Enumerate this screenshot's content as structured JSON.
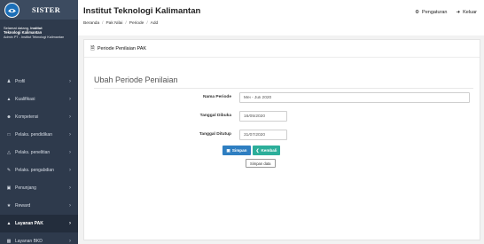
{
  "sidebar": {
    "brand": "SISTER",
    "welcome_prefix": "Selamat datang,",
    "username": "Institut",
    "institution": "Teknologi Kalimantan",
    "role": "Admin PT - Institut Teknologi Kalimantan",
    "items": [
      {
        "label": "Profil",
        "icon": "user-icon"
      },
      {
        "label": "Kualifikasi",
        "icon": "graduation-icon"
      },
      {
        "label": "Kompetensi",
        "icon": "users-icon"
      },
      {
        "label": "Pelaks. pendidikan",
        "icon": "book-icon"
      },
      {
        "label": "Pelaks. penelitian",
        "icon": "flask-icon"
      },
      {
        "label": "Pelaks. pengabdian",
        "icon": "handshake-icon"
      },
      {
        "label": "Penunjang",
        "icon": "briefcase-icon"
      },
      {
        "label": "Reward",
        "icon": "trophy-icon"
      },
      {
        "label": "Layanan PAK",
        "icon": "graduation-icon",
        "active": true
      },
      {
        "label": "Layanan BKD",
        "icon": "archive-icon"
      }
    ]
  },
  "header": {
    "title": "Institut Teknologi Kalimantan",
    "breadcrumb": [
      "Beranda",
      "Pak Nilai",
      "Periode",
      "Add"
    ],
    "settings_label": "Pengaturan",
    "logout_label": "Keluar"
  },
  "panel": {
    "heading": "Periode Penilaian PAK",
    "section_title": "Ubah Periode Penilaian",
    "fields": {
      "nama_periode": {
        "label": "Nama Periode",
        "value": "Mei - Juli 2020"
      },
      "tanggal_dibuka": {
        "label": "Tanggal Dibuka",
        "value": "16/05/2020"
      },
      "tanggal_ditutup": {
        "label": "Tanggal Ditutup",
        "value": "31/07/2020"
      }
    },
    "save_label": "Simpan",
    "back_label": "Kembali",
    "tooltip": "Simpan data"
  },
  "colors": {
    "sidebar_bg": "#2e3a4c",
    "primary": "#2e7ec1",
    "success": "#2cae9a"
  }
}
